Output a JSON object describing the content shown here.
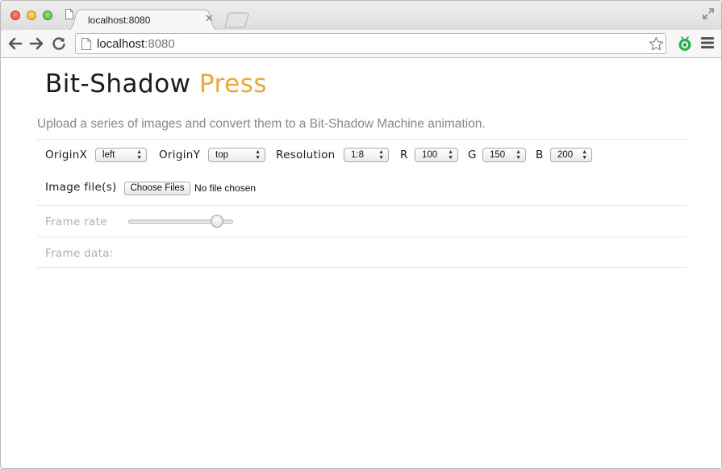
{
  "browser": {
    "tab_title": "localhost:8080",
    "url_host": "localhost",
    "url_port": ":8080",
    "icons": [
      "document-icon",
      "close-icon",
      "new-tab-icon",
      "fullscreen-icon",
      "back-arrow-icon",
      "forward-arrow-icon",
      "reload-icon",
      "bookmark-star-icon",
      "extension-icon",
      "hamburger-menu-icon"
    ]
  },
  "page": {
    "brand_main": "Bit-Shadow",
    "brand_accent": "Press",
    "accent_color": "#e8a93a",
    "subtitle": "Upload a series of images and convert them to a Bit-Shadow Machine animation.",
    "controls": {
      "originx_label": "OriginX",
      "originx_value": "left",
      "originy_label": "OriginY",
      "originy_value": "top",
      "resolution_label": "Resolution",
      "resolution_value": "1:8",
      "r_label": "R",
      "r_value": "100",
      "g_label": "G",
      "g_value": "150",
      "b_label": "B",
      "b_value": "200"
    },
    "file": {
      "label": "Image file(s)",
      "button": "Choose Files",
      "status": "No file chosen"
    },
    "frame_rate": {
      "label": "Frame rate",
      "level_fraction": 0.85
    },
    "frame_data": {
      "label": "Frame data:"
    }
  }
}
